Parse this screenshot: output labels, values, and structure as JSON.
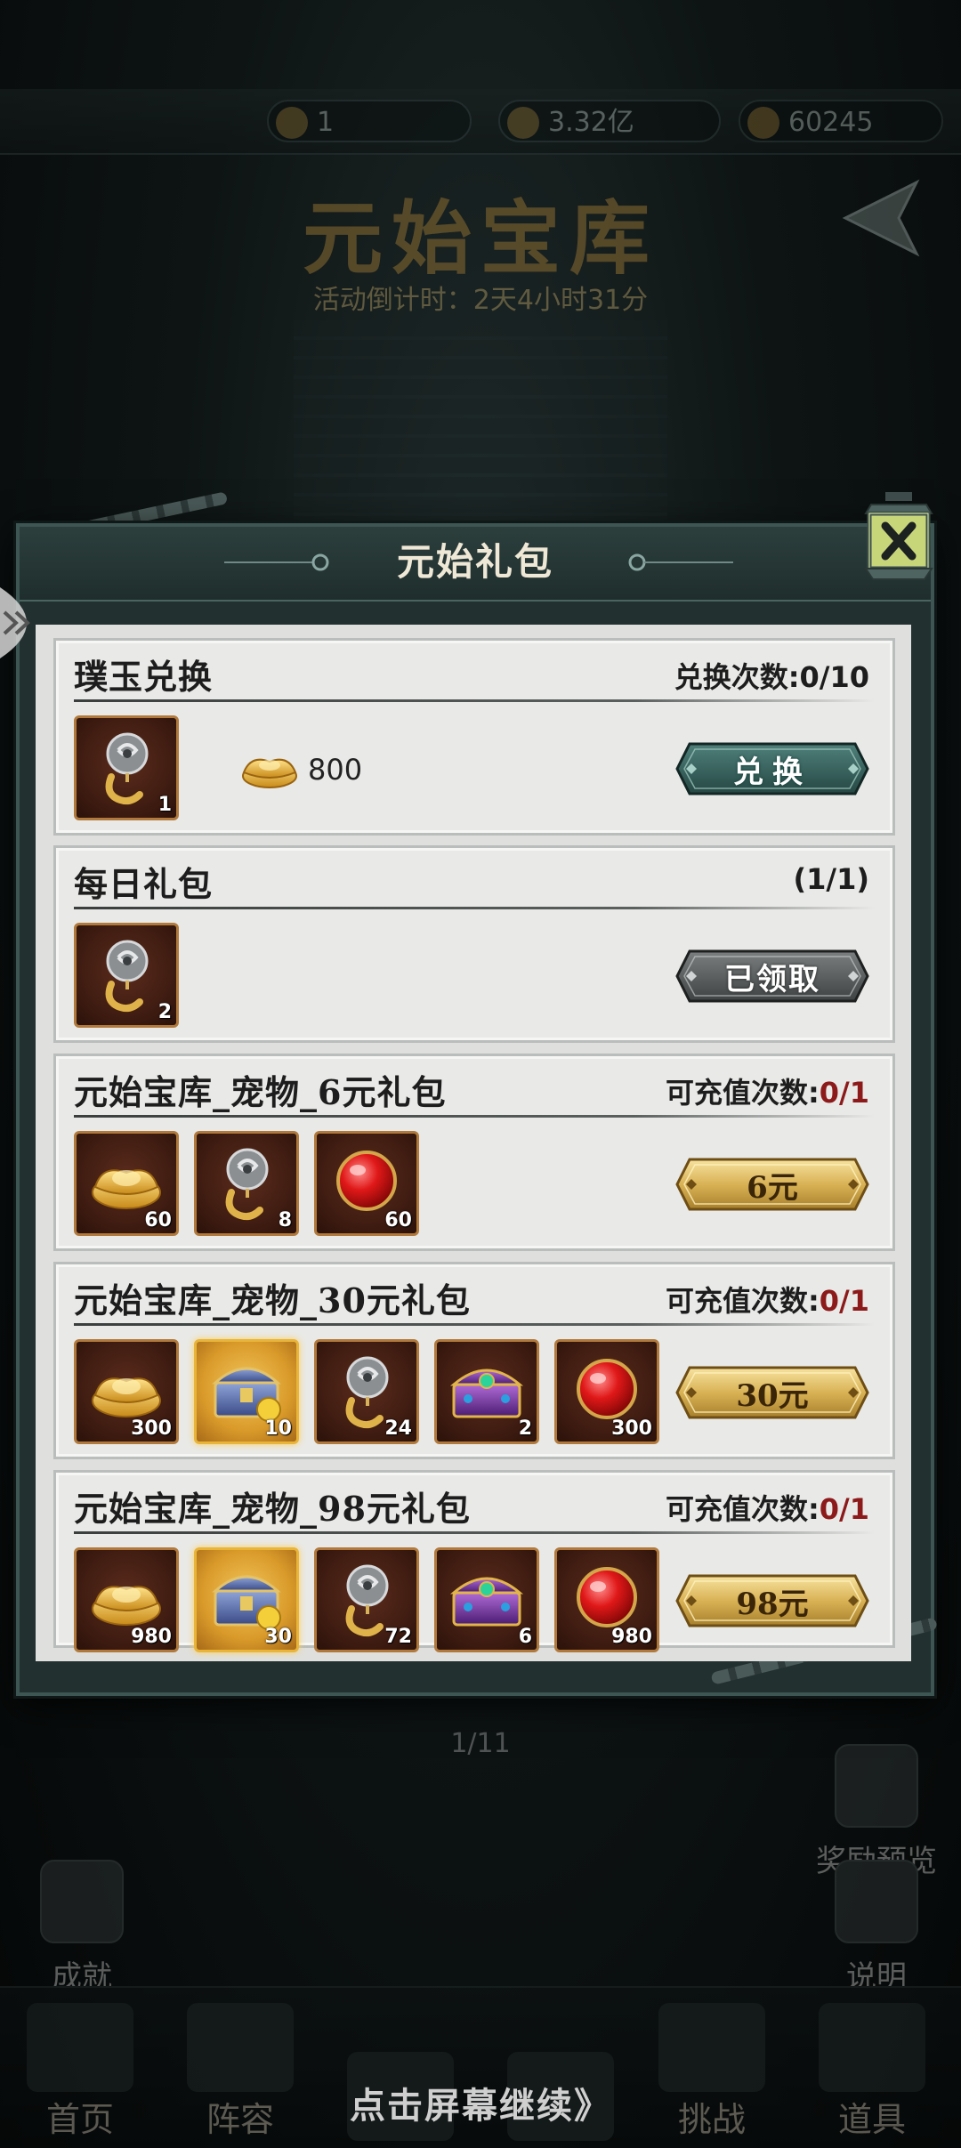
{
  "top_bar": {
    "res1": "1",
    "res2": "3.32亿",
    "res3": "60245"
  },
  "background": {
    "title": "元始宝库",
    "countdown": "活动倒计时：2天4小时31分",
    "page_indicator": "1/11",
    "side_buttons": {
      "reward_preview": "奖励预览",
      "achievement": "成就",
      "help": "说明"
    },
    "bottom_nav": [
      "首页",
      "阵容",
      "",
      "",
      "挑战",
      "道具"
    ],
    "continue_hint": "点击屏幕继续》"
  },
  "dialog": {
    "title": "元始礼包",
    "sections": [
      {
        "title": "璞玉兑换",
        "info_label": "兑换次数:",
        "info_value": "0/10",
        "items": [
          {
            "icon": "jade-pendant-icon",
            "qty": "1"
          }
        ],
        "price": {
          "icon": "gold-ingot-icon",
          "value": "800"
        },
        "button": {
          "label": "兑换",
          "style": "teal"
        }
      },
      {
        "title": "每日礼包",
        "info_label": "(1/1)",
        "info_value": "",
        "items": [
          {
            "icon": "jade-pendant-icon",
            "qty": "2"
          }
        ],
        "button": {
          "label": "已领取",
          "style": "grey"
        }
      },
      {
        "title": "元始宝库_宠物_6元礼包",
        "info_label": "可充值次数:",
        "info_value": "0/1",
        "items": [
          {
            "icon": "gold-ingot-icon",
            "qty": "60"
          },
          {
            "icon": "jade-pendant-icon",
            "qty": "8"
          },
          {
            "icon": "red-orb-icon",
            "qty": "60"
          }
        ],
        "button": {
          "label": "6元",
          "style": "gold"
        }
      },
      {
        "title": "元始宝库_宠物_30元礼包",
        "info_label": "可充值次数:",
        "info_value": "0/1",
        "items": [
          {
            "icon": "gold-ingot-icon",
            "qty": "300"
          },
          {
            "icon": "treasure-chest-icon",
            "qty": "10"
          },
          {
            "icon": "jade-pendant-icon",
            "qty": "24"
          },
          {
            "icon": "purple-chest-icon",
            "qty": "2"
          },
          {
            "icon": "red-orb-icon",
            "qty": "300"
          }
        ],
        "button": {
          "label": "30元",
          "style": "gold"
        }
      },
      {
        "title": "元始宝库_宠物_98元礼包",
        "info_label": "可充值次数:",
        "info_value": "0/1",
        "items": [
          {
            "icon": "gold-ingot-icon",
            "qty": "980"
          },
          {
            "icon": "treasure-chest-icon",
            "qty": "30"
          },
          {
            "icon": "jade-pendant-icon",
            "qty": "72"
          },
          {
            "icon": "purple-chest-icon",
            "qty": "6"
          },
          {
            "icon": "red-orb-icon",
            "qty": "980"
          }
        ],
        "button": {
          "label": "98元",
          "style": "gold"
        }
      }
    ]
  },
  "colors": {
    "panel": "#e9e9e7",
    "count_red": "#8c1a1a",
    "frame_teal": "#3d5653",
    "item_border": "#b17a3c",
    "gold_highlight": "#e8b43a"
  }
}
